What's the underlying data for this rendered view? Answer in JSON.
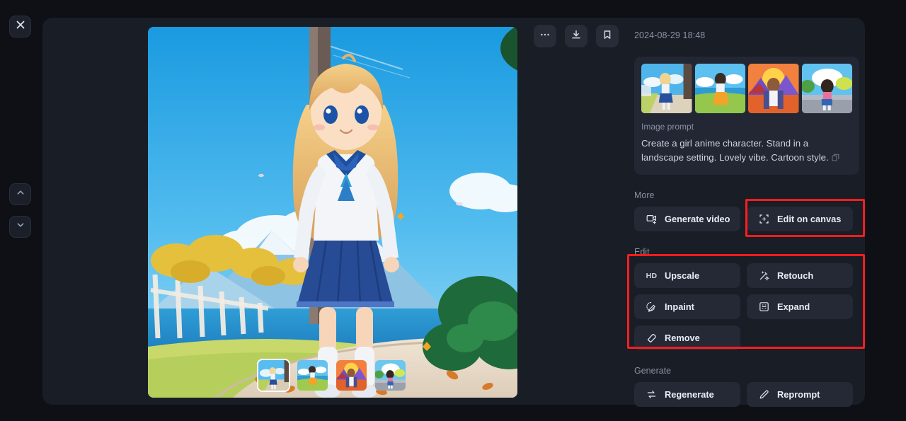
{
  "theme": {
    "page_bg": "#0e1016",
    "modal_bg": "#191d26",
    "card_bg": "#222733",
    "button_bg": "#242935",
    "accent_highlight": "#fe1d1d",
    "text_primary": "#e8ecf3",
    "text_muted": "#8a90a0"
  },
  "left_rail": {
    "close_label": "Close",
    "prev_label": "Previous",
    "next_label": "Next"
  },
  "toolbar": {
    "more_label": "More options",
    "download_label": "Download",
    "bookmark_label": "Bookmark"
  },
  "panel": {
    "timestamp": "2024-08-29 18:48",
    "prompt": {
      "label": "Image prompt",
      "text": "Create a girl anime character. Stand in a landscape setting. Lovely vibe. Cartoon style.",
      "copy_label": "Copy prompt",
      "thumbnails": [
        {
          "name": "prompt-ref-1",
          "alt": "Blonde girl in blue dress on forest path"
        },
        {
          "name": "prompt-ref-2",
          "alt": "Girl in white top and orange skirt on green hill"
        },
        {
          "name": "prompt-ref-3",
          "alt": "Girl with sunset and purple mountains"
        },
        {
          "name": "prompt-ref-4",
          "alt": "Girl in pink top and blue skirt on road"
        }
      ]
    },
    "sections": [
      {
        "id": "more",
        "label": "More",
        "buttons": [
          {
            "id": "generate-video",
            "label": "Generate video",
            "icon": "video-plus-icon"
          },
          {
            "id": "edit-on-canvas",
            "label": "Edit on canvas",
            "icon": "canvas-crop-icon",
            "highlighted": true
          }
        ]
      },
      {
        "id": "edit",
        "label": "Edit",
        "highlighted": true,
        "buttons": [
          {
            "id": "upscale",
            "label": "Upscale",
            "icon": "hd-icon",
            "icon_text": "HD"
          },
          {
            "id": "retouch",
            "label": "Retouch",
            "icon": "magic-wand-icon"
          },
          {
            "id": "inpaint",
            "label": "Inpaint",
            "icon": "inpaint-brush-icon"
          },
          {
            "id": "expand",
            "label": "Expand",
            "icon": "expand-frame-icon"
          },
          {
            "id": "remove",
            "label": "Remove",
            "icon": "eraser-icon"
          }
        ]
      },
      {
        "id": "generate",
        "label": "Generate",
        "buttons": [
          {
            "id": "regenerate",
            "label": "Regenerate",
            "icon": "refresh-icon"
          },
          {
            "id": "reprompt",
            "label": "Reprompt",
            "icon": "pencil-icon"
          }
        ]
      }
    ]
  },
  "stage": {
    "hero_alt": "Anime girl in sailor uniform standing on a path by a lake with mountains",
    "variants": [
      {
        "name": "variant-1",
        "alt": "Blonde girl in sailor uniform",
        "selected": true
      },
      {
        "name": "variant-2",
        "alt": "Girl in orange skirt on green hill",
        "selected": false
      },
      {
        "name": "variant-3",
        "alt": "Girl with purple mountains sunset",
        "selected": false
      },
      {
        "name": "variant-4",
        "alt": "Girl in blue skirt on road",
        "selected": false
      }
    ]
  }
}
